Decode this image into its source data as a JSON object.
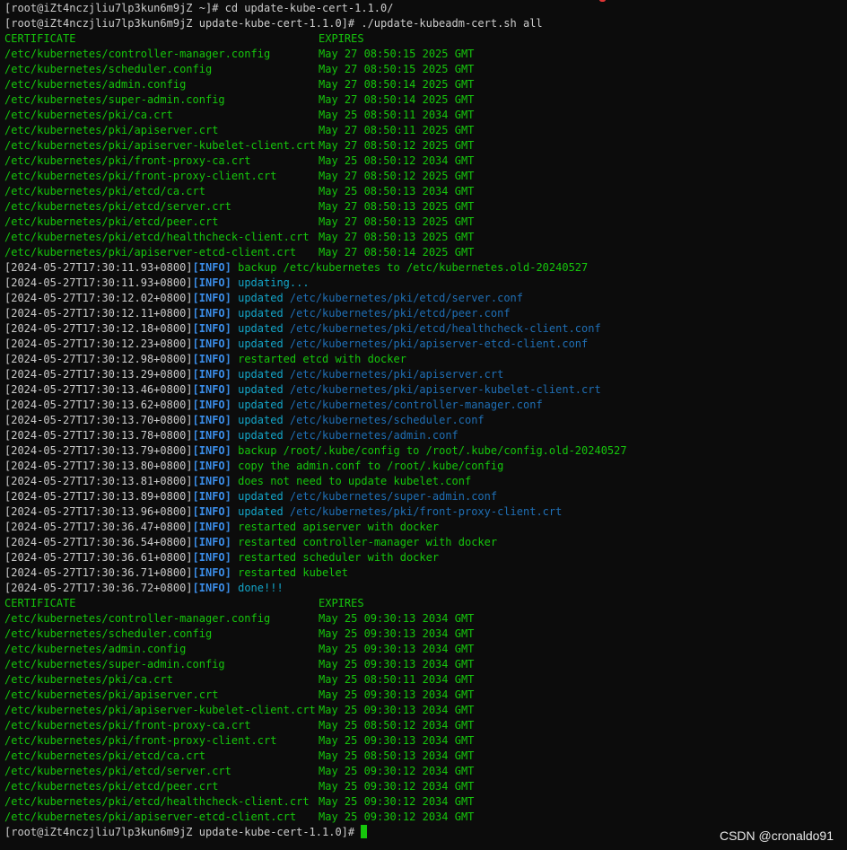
{
  "prompt": {
    "first": "[root@iZt4nczjliu7lp3kun6m9jZ ~]# cd update-kube-cert-1.1.0/",
    "second": "[root@iZt4nczjliu7lp3kun6m9jZ update-kube-cert-1.1.0]# ./update-kubeadm-cert.sh all",
    "last": "[root@iZt4nczjliu7lp3kun6m9jZ update-kube-cert-1.1.0]# "
  },
  "before": {
    "header_cert": "CERTIFICATE",
    "header_expires": "EXPIRES",
    "rows": [
      {
        "path": "/etc/kubernetes/controller-manager.config",
        "expires": "May 27 08:50:15 2025 GMT"
      },
      {
        "path": "/etc/kubernetes/scheduler.config",
        "expires": "May 27 08:50:15 2025 GMT"
      },
      {
        "path": "/etc/kubernetes/admin.config",
        "expires": "May 27 08:50:14 2025 GMT"
      },
      {
        "path": "/etc/kubernetes/super-admin.config",
        "expires": "May 27 08:50:14 2025 GMT"
      },
      {
        "path": "/etc/kubernetes/pki/ca.crt",
        "expires": "May 25 08:50:11 2034 GMT"
      },
      {
        "path": "/etc/kubernetes/pki/apiserver.crt",
        "expires": "May 27 08:50:11 2025 GMT"
      },
      {
        "path": "/etc/kubernetes/pki/apiserver-kubelet-client.crt",
        "expires": "May 27 08:50:12 2025 GMT"
      },
      {
        "path": "/etc/kubernetes/pki/front-proxy-ca.crt",
        "expires": "May 25 08:50:12 2034 GMT"
      },
      {
        "path": "/etc/kubernetes/pki/front-proxy-client.crt",
        "expires": "May 27 08:50:12 2025 GMT"
      },
      {
        "path": "/etc/kubernetes/pki/etcd/ca.crt",
        "expires": "May 25 08:50:13 2034 GMT"
      },
      {
        "path": "/etc/kubernetes/pki/etcd/server.crt",
        "expires": "May 27 08:50:13 2025 GMT"
      },
      {
        "path": "/etc/kubernetes/pki/etcd/peer.crt",
        "expires": "May 27 08:50:13 2025 GMT"
      },
      {
        "path": "/etc/kubernetes/pki/etcd/healthcheck-client.crt",
        "expires": "May 27 08:50:13 2025 GMT"
      },
      {
        "path": "/etc/kubernetes/pki/apiserver-etcd-client.crt",
        "expires": "May 27 08:50:14 2025 GMT"
      }
    ]
  },
  "log": [
    {
      "ts": "[2024-05-27T17:30:11.93+0800]",
      "level": "[INFO]",
      "msg": "backup /etc/kubernetes to /etc/kubernetes.old-20240527",
      "style": "green"
    },
    {
      "ts": "[2024-05-27T17:30:11.93+0800]",
      "level": "[INFO]",
      "msg": "updating...",
      "style": "cyan"
    },
    {
      "ts": "[2024-05-27T17:30:12.02+0800]",
      "level": "[INFO]",
      "verb": "updated",
      "msg": "/etc/kubernetes/pki/etcd/server.conf",
      "style": "updated"
    },
    {
      "ts": "[2024-05-27T17:30:12.11+0800]",
      "level": "[INFO]",
      "verb": "updated",
      "msg": "/etc/kubernetes/pki/etcd/peer.conf",
      "style": "updated"
    },
    {
      "ts": "[2024-05-27T17:30:12.18+0800]",
      "level": "[INFO]",
      "verb": "updated",
      "msg": "/etc/kubernetes/pki/etcd/healthcheck-client.conf",
      "style": "updated"
    },
    {
      "ts": "[2024-05-27T17:30:12.23+0800]",
      "level": "[INFO]",
      "verb": "updated",
      "msg": "/etc/kubernetes/pki/apiserver-etcd-client.conf",
      "style": "updated"
    },
    {
      "ts": "[2024-05-27T17:30:12.98+0800]",
      "level": "[INFO]",
      "msg": "restarted etcd with docker",
      "style": "green"
    },
    {
      "ts": "[2024-05-27T17:30:13.29+0800]",
      "level": "[INFO]",
      "verb": "updated",
      "msg": "/etc/kubernetes/pki/apiserver.crt",
      "style": "updated"
    },
    {
      "ts": "[2024-05-27T17:30:13.46+0800]",
      "level": "[INFO]",
      "verb": "updated",
      "msg": "/etc/kubernetes/pki/apiserver-kubelet-client.crt",
      "style": "updated"
    },
    {
      "ts": "[2024-05-27T17:30:13.62+0800]",
      "level": "[INFO]",
      "verb": "updated",
      "msg": "/etc/kubernetes/controller-manager.conf",
      "style": "updated"
    },
    {
      "ts": "[2024-05-27T17:30:13.70+0800]",
      "level": "[INFO]",
      "verb": "updated",
      "msg": "/etc/kubernetes/scheduler.conf",
      "style": "updated"
    },
    {
      "ts": "[2024-05-27T17:30:13.78+0800]",
      "level": "[INFO]",
      "verb": "updated",
      "msg": "/etc/kubernetes/admin.conf",
      "style": "updated"
    },
    {
      "ts": "[2024-05-27T17:30:13.79+0800]",
      "level": "[INFO]",
      "msg": "backup /root/.kube/config to /root/.kube/config.old-20240527",
      "style": "green"
    },
    {
      "ts": "[2024-05-27T17:30:13.80+0800]",
      "level": "[INFO]",
      "msg": "copy the admin.conf to /root/.kube/config",
      "style": "green"
    },
    {
      "ts": "[2024-05-27T17:30:13.81+0800]",
      "level": "[INFO]",
      "msg": "does not need to update kubelet.conf",
      "style": "green"
    },
    {
      "ts": "[2024-05-27T17:30:13.89+0800]",
      "level": "[INFO]",
      "verb": "updated",
      "msg": "/etc/kubernetes/super-admin.conf",
      "style": "updated"
    },
    {
      "ts": "[2024-05-27T17:30:13.96+0800]",
      "level": "[INFO]",
      "verb": "updated",
      "msg": "/etc/kubernetes/pki/front-proxy-client.crt",
      "style": "updated"
    },
    {
      "ts": "[2024-05-27T17:30:36.47+0800]",
      "level": "[INFO]",
      "msg": "restarted apiserver with docker",
      "style": "green"
    },
    {
      "ts": "[2024-05-27T17:30:36.54+0800]",
      "level": "[INFO]",
      "msg": "restarted controller-manager with docker",
      "style": "green"
    },
    {
      "ts": "[2024-05-27T17:30:36.61+0800]",
      "level": "[INFO]",
      "msg": "restarted scheduler with docker",
      "style": "green"
    },
    {
      "ts": "[2024-05-27T17:30:36.71+0800]",
      "level": "[INFO]",
      "msg": "restarted kubelet",
      "style": "green"
    },
    {
      "ts": "[2024-05-27T17:30:36.72+0800]",
      "level": "[INFO]",
      "msg": "done!!!",
      "style": "cyan"
    }
  ],
  "after": {
    "header_cert": "CERTIFICATE",
    "header_expires": "EXPIRES",
    "rows": [
      {
        "path": "/etc/kubernetes/controller-manager.config",
        "expires": "May 25 09:30:13 2034 GMT"
      },
      {
        "path": "/etc/kubernetes/scheduler.config",
        "expires": "May 25 09:30:13 2034 GMT"
      },
      {
        "path": "/etc/kubernetes/admin.config",
        "expires": "May 25 09:30:13 2034 GMT"
      },
      {
        "path": "/etc/kubernetes/super-admin.config",
        "expires": "May 25 09:30:13 2034 GMT"
      },
      {
        "path": "/etc/kubernetes/pki/ca.crt",
        "expires": "May 25 08:50:11 2034 GMT"
      },
      {
        "path": "/etc/kubernetes/pki/apiserver.crt",
        "expires": "May 25 09:30:13 2034 GMT"
      },
      {
        "path": "/etc/kubernetes/pki/apiserver-kubelet-client.crt",
        "expires": "May 25 09:30:13 2034 GMT"
      },
      {
        "path": "/etc/kubernetes/pki/front-proxy-ca.crt",
        "expires": "May 25 08:50:12 2034 GMT"
      },
      {
        "path": "/etc/kubernetes/pki/front-proxy-client.crt",
        "expires": "May 25 09:30:13 2034 GMT"
      },
      {
        "path": "/etc/kubernetes/pki/etcd/ca.crt",
        "expires": "May 25 08:50:13 2034 GMT"
      },
      {
        "path": "/etc/kubernetes/pki/etcd/server.crt",
        "expires": "May 25 09:30:12 2034 GMT"
      },
      {
        "path": "/etc/kubernetes/pki/etcd/peer.crt",
        "expires": "May 25 09:30:12 2034 GMT"
      },
      {
        "path": "/etc/kubernetes/pki/etcd/healthcheck-client.crt",
        "expires": "May 25 09:30:12 2034 GMT"
      },
      {
        "path": "/etc/kubernetes/pki/apiserver-etcd-client.crt",
        "expires": "May 25 09:30:12 2034 GMT"
      }
    ]
  },
  "watermark": "CSDN @cronaldo91",
  "colors": {
    "background": "#0c0c0c",
    "green": "#16c60c",
    "cyan": "#13a5c8",
    "path_blue": "#1f6fb5",
    "info_blue": "#3b8eea",
    "text": "#cccccc"
  }
}
